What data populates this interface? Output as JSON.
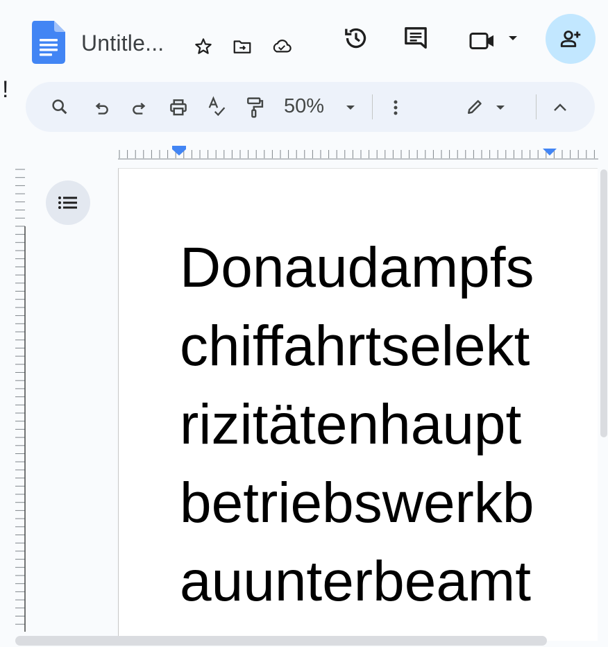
{
  "app": {
    "document_title": "Untitle...",
    "zoom": "50%"
  },
  "header": {
    "icons": [
      "docs-logo-icon",
      "star-icon",
      "move-to-folder-icon",
      "cloud-saved-icon",
      "version-history-icon",
      "comments-icon",
      "meet-camera-icon",
      "chevron-down-icon",
      "add-person-share-icon"
    ]
  },
  "toolbar": {
    "icons": [
      "search-icon",
      "undo-icon",
      "redo-icon",
      "print-icon",
      "spellcheck-icon",
      "paint-format-icon",
      "zoom-dropdown-icon",
      "more-vert-icon",
      "edit-mode-pencil-icon",
      "chevron-down-icon",
      "collapse-chevron-up-icon"
    ]
  },
  "stray_glyph": "!",
  "document": {
    "lines": [
      "Donaudampfs",
      "chiffahrtselekt",
      "rizitätenhaupt",
      "betriebswerkb",
      "auunterbeamt"
    ]
  },
  "colors": {
    "background": "#f9fbfd",
    "toolbar": "#edf2fa",
    "share_button": "#c2e7ff",
    "docs_blue": "#4285f4",
    "ruler_marker": "#4285f4"
  }
}
